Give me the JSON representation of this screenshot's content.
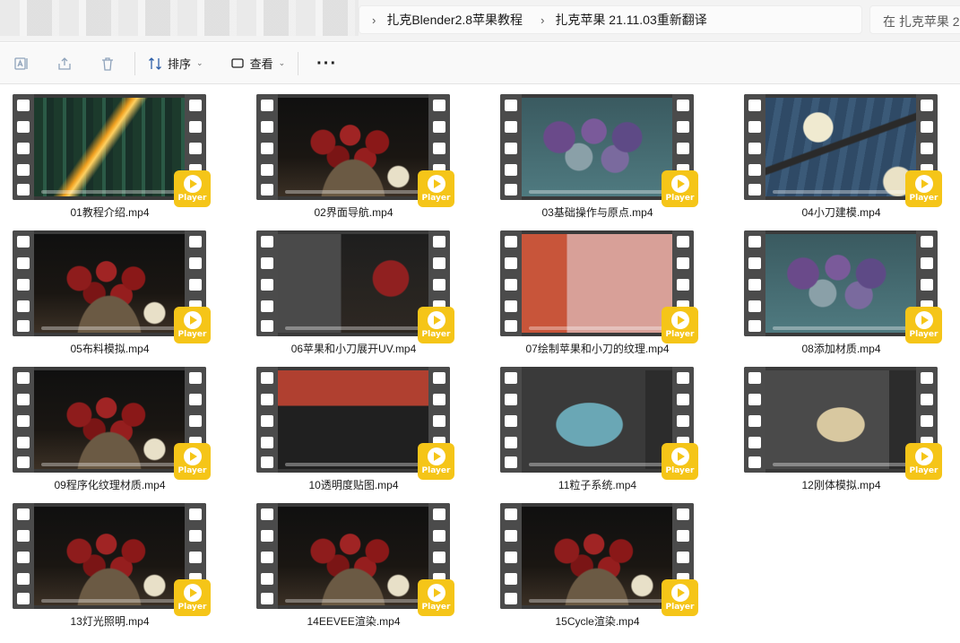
{
  "address_bar": {
    "breadcrumb": [
      "扎克Blender2.8苹果教程",
      "扎克苹果 21.11.03重新翻译"
    ],
    "search_placeholder": "在 扎克苹果 2"
  },
  "toolbar": {
    "icons": [
      "rename-icon",
      "share-icon",
      "delete-icon"
    ],
    "sort_label": "排序",
    "view_label": "查看",
    "more_label": "···"
  },
  "files": [
    {
      "name": "01教程介绍.mp4",
      "scene": "city"
    },
    {
      "name": "02界面导航.mp4",
      "scene": "apple"
    },
    {
      "name": "03基础操作与原点.mp4",
      "scene": "blue"
    },
    {
      "name": "04小刀建模.mp4",
      "scene": "knife"
    },
    {
      "name": "05布料模拟.mp4",
      "scene": "apple"
    },
    {
      "name": "06苹果和小刀展开UV.mp4",
      "scene": "uv"
    },
    {
      "name": "07绘制苹果和小刀的纹理.mp4",
      "scene": "tex"
    },
    {
      "name": "08添加材质.mp4",
      "scene": "blue"
    },
    {
      "name": "09程序化纹理材质.mp4",
      "scene": "apple"
    },
    {
      "name": "10透明度贴图.mp4",
      "scene": "node"
    },
    {
      "name": "11粒子系统.mp4",
      "scene": "apple3d"
    },
    {
      "name": "12刚体模拟.mp4",
      "scene": "rigid"
    },
    {
      "name": "13灯光照明.mp4",
      "scene": "apple"
    },
    {
      "name": "14EEVEE渲染.mp4",
      "scene": "apple"
    },
    {
      "name": "15Cycle渲染.mp4",
      "scene": "apple"
    }
  ],
  "player_badge": "Player",
  "colors": {
    "player": "#f5c518",
    "sprocket": "#4b4b4b"
  }
}
